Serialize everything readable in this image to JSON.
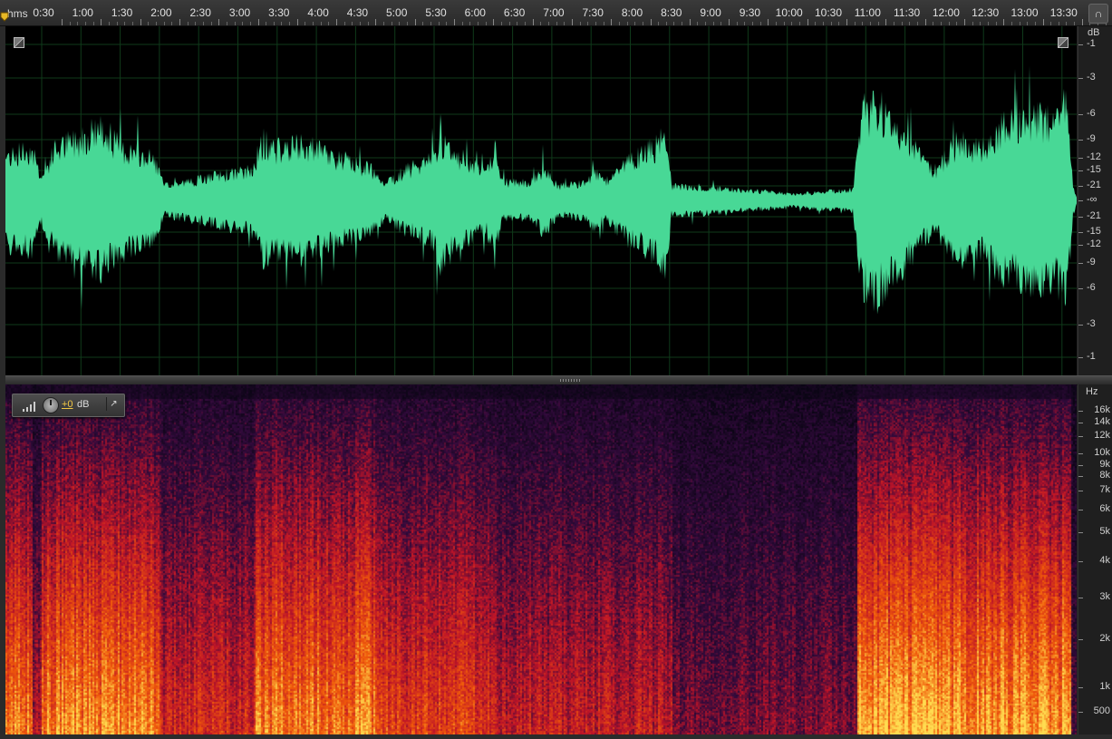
{
  "ruler": {
    "unit_label": "hms",
    "ticks": [
      "0:30",
      "1:00",
      "1:30",
      "2:00",
      "2:30",
      "3:00",
      "3:30",
      "4:00",
      "4:30",
      "5:00",
      "5:30",
      "6:00",
      "6:30",
      "7:00",
      "7:30",
      "8:00",
      "8:30",
      "9:00",
      "9:30",
      "10:00",
      "10:30",
      "11:00",
      "11:30",
      "12:00",
      "12:30",
      "13:00",
      "13:30"
    ]
  },
  "waveform_scale": {
    "unit": "dB",
    "labels_top": [
      "-1",
      "-3",
      "-6",
      "-9",
      "-12",
      "-15",
      "-21"
    ],
    "center": "-∞",
    "labels_bottom": [
      "-21",
      "-15",
      "-12",
      "-9",
      "-6",
      "-3",
      "-1"
    ]
  },
  "spectral_scale": {
    "unit": "Hz",
    "labels": [
      "16k",
      "14k",
      "12k",
      "10k",
      "9k",
      "8k",
      "7k",
      "6k",
      "5k",
      "4k",
      "3k",
      "2k",
      "1k",
      "500"
    ]
  },
  "hud": {
    "gain": "+0",
    "unit": "dB"
  },
  "colors": {
    "waveform": "#48d896",
    "background": "#000000",
    "grid": "#0f3a1a",
    "spectral_low": "#2a0a3a",
    "spectral_mid": "#c01a10",
    "spectral_high": "#ffd050"
  },
  "icons": {
    "headphones": "headphones-icon",
    "playhead": "playhead-marker-icon",
    "pin": "pin-icon",
    "knob": "knob-icon",
    "level": "level-bars-icon"
  }
}
